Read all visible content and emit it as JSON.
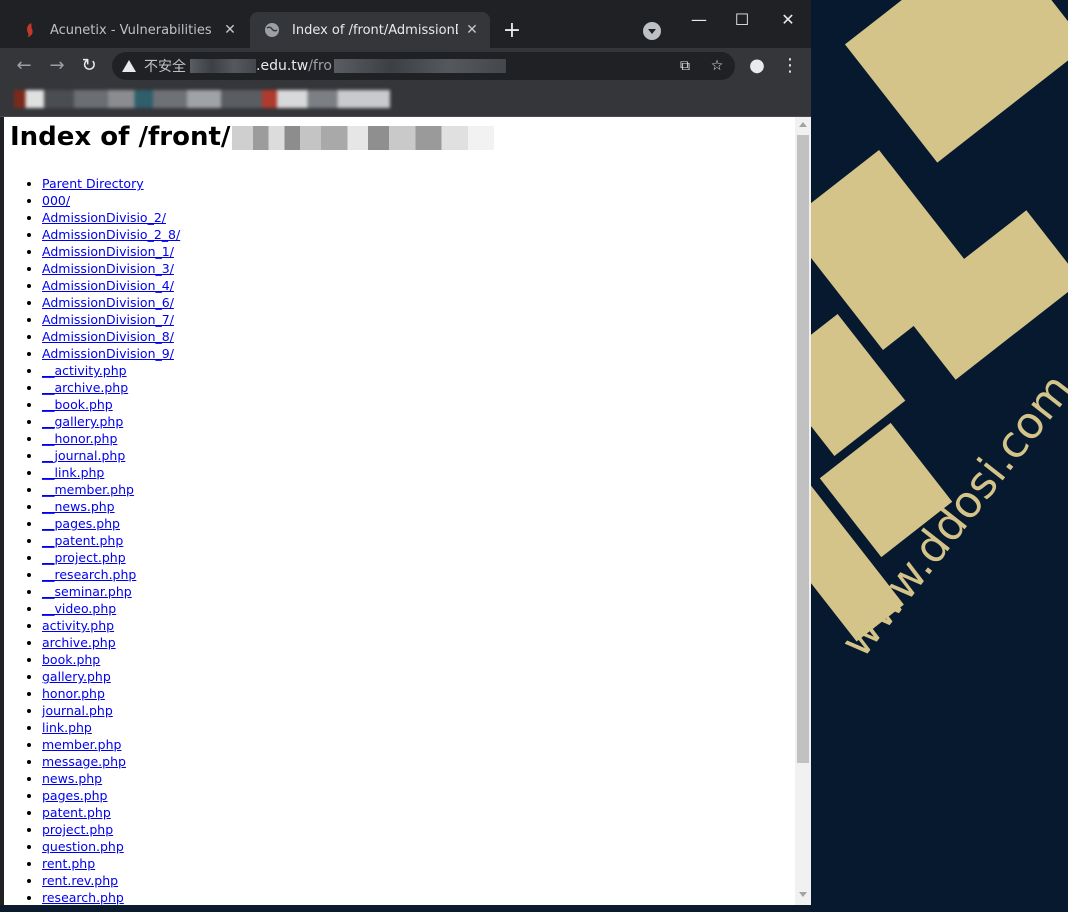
{
  "browser": {
    "tabs": [
      {
        "title": "Acunetix - Vulnerabilities",
        "active": false,
        "favicon": "acunetix-logo-icon"
      },
      {
        "title": "Index of /front/AdmissionDivis",
        "active": true,
        "favicon": "globe-icon"
      }
    ],
    "new_tab_label": "+",
    "address": {
      "security_label": "不安全",
      "host_visible": ".edu.tw",
      "path_visible": "/fro"
    }
  },
  "page": {
    "heading": "Index of /front/",
    "entries": [
      "Parent Directory",
      "000/",
      "AdmissionDivisio_2/",
      "AdmissionDivisio_2_8/",
      "AdmissionDivision_1/",
      "AdmissionDivision_3/",
      "AdmissionDivision_4/",
      "AdmissionDivision_6/",
      "AdmissionDivision_7/",
      "AdmissionDivision_8/",
      "AdmissionDivision_9/",
      "__activity.php",
      "__archive.php",
      "__book.php",
      "__gallery.php",
      "__honor.php",
      "__journal.php",
      "__link.php",
      "__member.php",
      "__news.php",
      "__pages.php",
      "__patent.php",
      "__project.php",
      "__research.php",
      "__seminar.php",
      "__video.php",
      "activity.php",
      "archive.php",
      "book.php",
      "gallery.php",
      "honor.php",
      "journal.php",
      "link.php",
      "member.php",
      "message.php",
      "news.php",
      "pages.php",
      "patent.php",
      "project.php",
      "question.php",
      "rent.php",
      "rent.rev.php",
      "research.php"
    ]
  },
  "wallpaper": {
    "watermark": "www.ddosi.com",
    "colors": {
      "background": "#06192e",
      "accent": "#d4c48a"
    }
  }
}
